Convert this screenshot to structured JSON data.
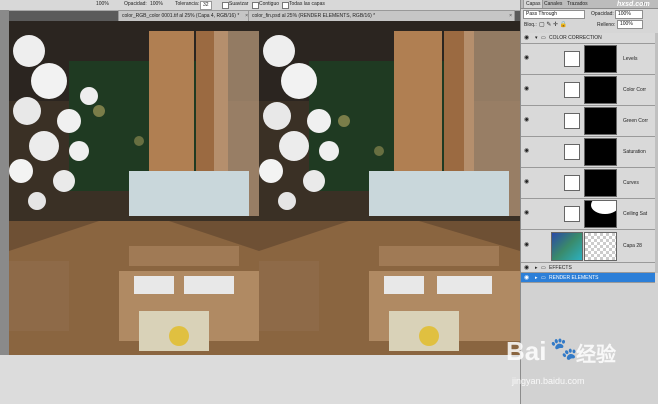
{
  "options_bar": {
    "zoom": "100%",
    "opacity_label": "Opacidad:",
    "opacity_value": "100%",
    "tolerance_label": "Tolerancia:",
    "tolerance_value": "32",
    "antialias_label": "Suavizar",
    "contiguous_label": "Contiguo",
    "all_layers_label": "Todas las capas"
  },
  "documents": [
    {
      "tab": "color_RGB_color 0001.tif al 25% (Capa 4, RGB/16) *",
      "close": "×"
    },
    {
      "tab": "color_fin.psd al 25% (RENDER ELEMENTS, RGB/16) *",
      "close": "×"
    }
  ],
  "panel": {
    "tabs": [
      "Capas",
      "Canales",
      "Trazados"
    ],
    "blend_mode": "Pass Through",
    "opacity_label": "Opacidad:",
    "opacity_value": "100%",
    "lock_label": "Bloq.:",
    "fill_label": "Relleno:",
    "fill_value": "100%",
    "layers": [
      {
        "name": "COLOR CORRECTION",
        "kind": "group",
        "visible": true
      },
      {
        "name": "Levels",
        "kind": "adjustment",
        "icon": "levels-icon",
        "visible": true
      },
      {
        "name": "Color Corr",
        "kind": "adjustment",
        "icon": "color-balance-icon",
        "visible": true
      },
      {
        "name": "Green Corr",
        "kind": "adjustment",
        "icon": "curves-icon",
        "visible": true
      },
      {
        "name": "Saturation",
        "kind": "adjustment",
        "icon": "hue-saturation-icon",
        "visible": true
      },
      {
        "name": "Curves",
        "kind": "adjustment",
        "icon": "curves-icon",
        "visible": true
      },
      {
        "name": "Ceiling Sat",
        "kind": "adjustment",
        "icon": "curves-icon",
        "visible": true
      },
      {
        "name": "Capa 28",
        "kind": "pixel",
        "visible": true
      },
      {
        "name": "EFFECTS",
        "kind": "group",
        "visible": true
      },
      {
        "name": "RENDER ELEMENTS",
        "kind": "group",
        "visible": true,
        "selected": true
      }
    ]
  },
  "watermark": {
    "site_top": "hxsd.com",
    "brand": "Bai",
    "brand_suffix": "经验",
    "url": "jingyan.baidu.com"
  },
  "colors": {
    "selection": "#2c7fd8",
    "panel_bg": "#d6d6d6"
  }
}
